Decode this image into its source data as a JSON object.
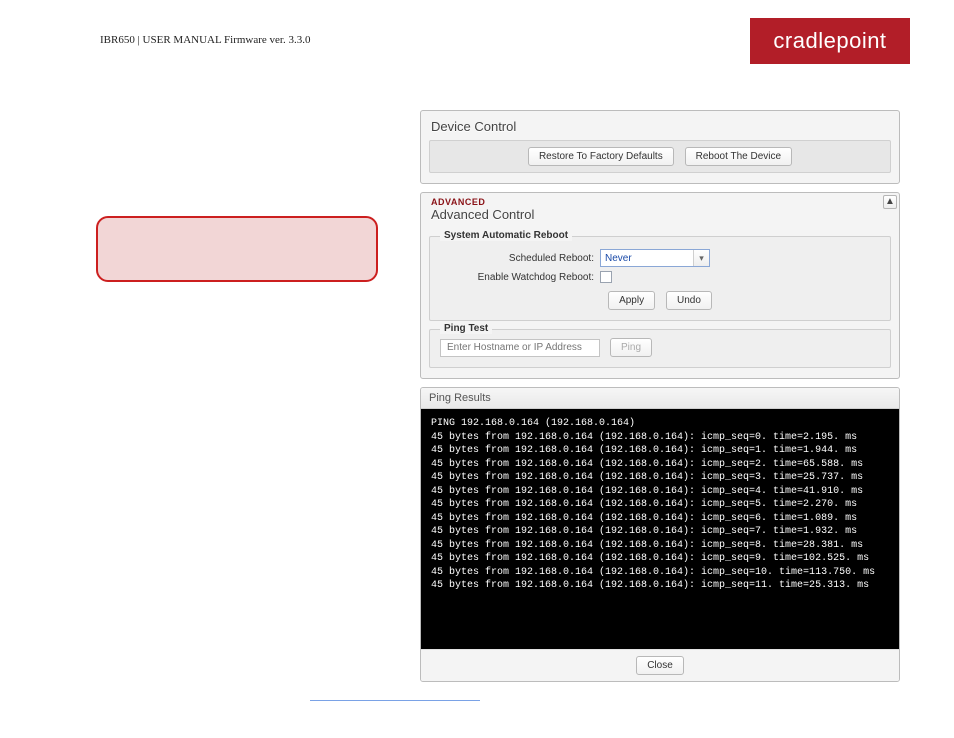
{
  "header": {
    "title": "IBR650 | USER MANUAL Firmware ver. 3.3.0",
    "brand": "cradlepoint"
  },
  "device_control": {
    "title": "Device Control",
    "restore_btn": "Restore To Factory Defaults",
    "reboot_btn": "Reboot The Device"
  },
  "advanced": {
    "tag": "ADVANCED",
    "title": "Advanced Control",
    "collapse_glyph": "▲",
    "auto_reboot": {
      "legend": "System Automatic Reboot",
      "scheduled_label": "Scheduled Reboot:",
      "scheduled_value": "Never",
      "watchdog_label": "Enable Watchdog Reboot:",
      "apply_btn": "Apply",
      "undo_btn": "Undo"
    },
    "ping_test": {
      "legend": "Ping Test",
      "placeholder": "Enter Hostname or IP Address",
      "ping_btn": "Ping"
    }
  },
  "ping_results": {
    "title": "Ping Results",
    "lines": [
      "PING 192.168.0.164 (192.168.0.164)",
      "45 bytes from 192.168.0.164 (192.168.0.164): icmp_seq=0. time=2.195. ms",
      "45 bytes from 192.168.0.164 (192.168.0.164): icmp_seq=1. time=1.944. ms",
      "45 bytes from 192.168.0.164 (192.168.0.164): icmp_seq=2. time=65.588. ms",
      "45 bytes from 192.168.0.164 (192.168.0.164): icmp_seq=3. time=25.737. ms",
      "45 bytes from 192.168.0.164 (192.168.0.164): icmp_seq=4. time=41.910. ms",
      "45 bytes from 192.168.0.164 (192.168.0.164): icmp_seq=5. time=2.270. ms",
      "45 bytes from 192.168.0.164 (192.168.0.164): icmp_seq=6. time=1.089. ms",
      "45 bytes from 192.168.0.164 (192.168.0.164): icmp_seq=7. time=1.932. ms",
      "45 bytes from 192.168.0.164 (192.168.0.164): icmp_seq=8. time=28.381. ms",
      "45 bytes from 192.168.0.164 (192.168.0.164): icmp_seq=9. time=102.525. ms",
      "45 bytes from 192.168.0.164 (192.168.0.164): icmp_seq=10. time=113.750. ms",
      "45 bytes from 192.168.0.164 (192.168.0.164): icmp_seq=11. time=25.313. ms"
    ],
    "close_btn": "Close"
  }
}
